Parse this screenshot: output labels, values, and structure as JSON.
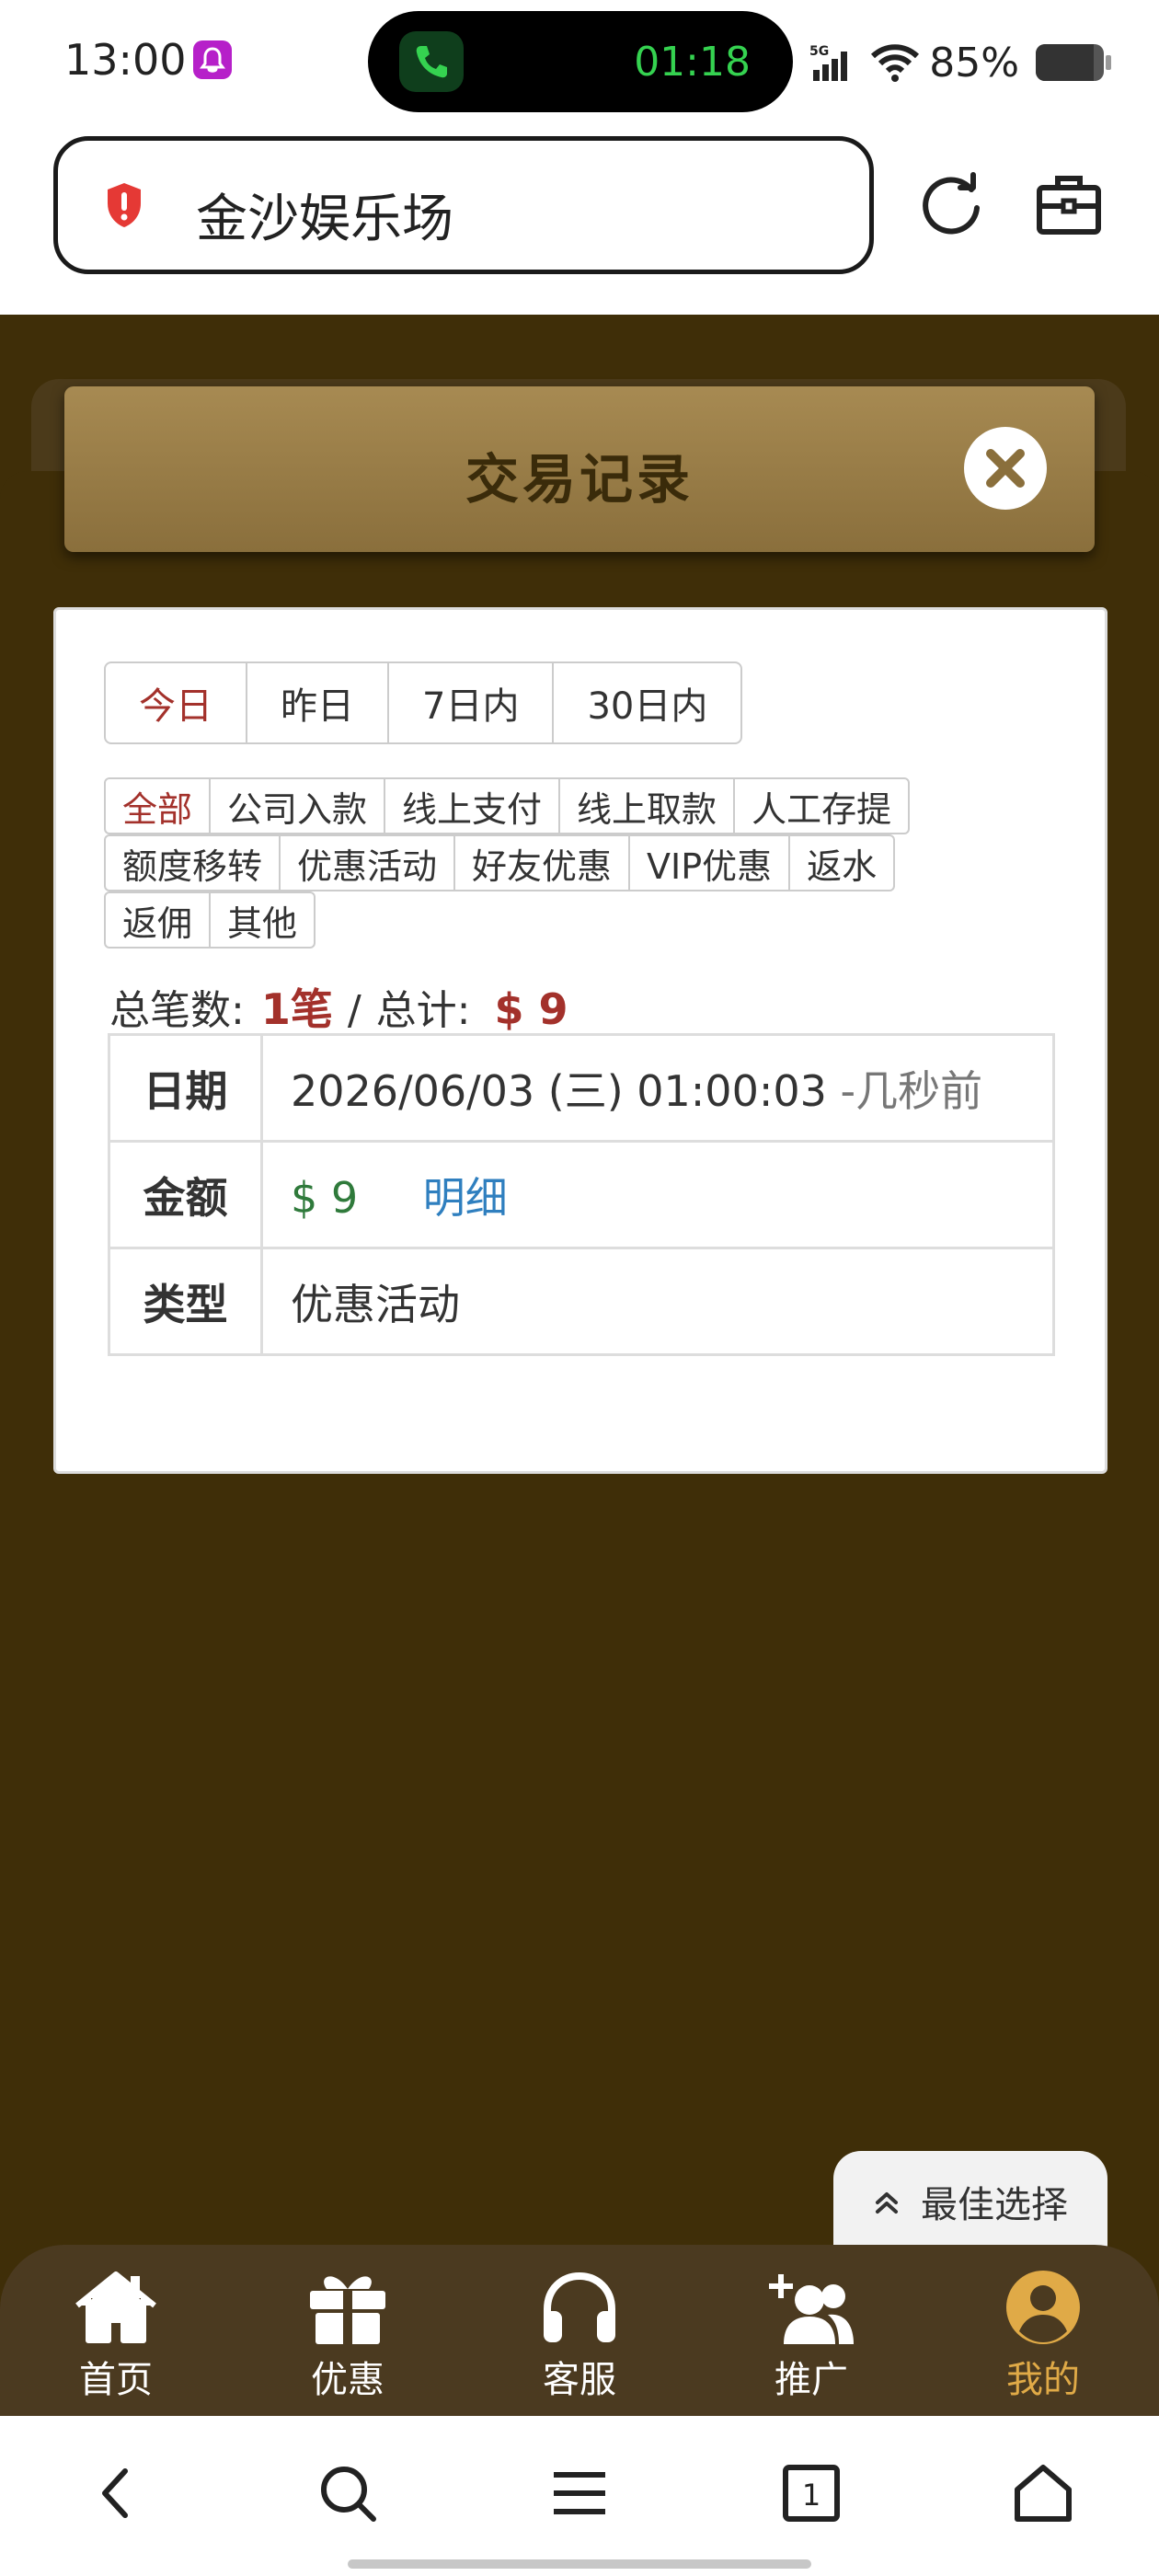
{
  "status_bar": {
    "time": "13:00",
    "call_timer": "01:18",
    "network": "5G",
    "battery_percent_label": "85%",
    "battery_level": 0.85
  },
  "address_bar": {
    "site_title": "金沙娱乐场"
  },
  "header": {
    "title": "交易记录"
  },
  "day_tabs": [
    {
      "label": "今日",
      "active": true
    },
    {
      "label": "昨日",
      "active": false
    },
    {
      "label": "7日内",
      "active": false
    },
    {
      "label": "30日内",
      "active": false
    }
  ],
  "type_filters": [
    [
      {
        "label": "全部",
        "active": true
      },
      {
        "label": "公司入款"
      },
      {
        "label": "线上支付"
      },
      {
        "label": "线上取款"
      },
      {
        "label": "人工存提"
      }
    ],
    [
      {
        "label": "额度移转"
      },
      {
        "label": "优惠活动"
      },
      {
        "label": "好友优惠"
      },
      {
        "label": "VIP优惠"
      },
      {
        "label": "返水"
      }
    ],
    [
      {
        "label": "返佣"
      },
      {
        "label": "其他"
      }
    ]
  ],
  "summary": {
    "count_label": "总笔数:",
    "count_value": "1笔",
    "separator": "/",
    "total_label": "总计:",
    "total_value": "$ 9"
  },
  "record": {
    "date_key": "日期",
    "date_value": "2026/06/03 (三) 01:00:03",
    "date_ago": "-几秒前",
    "amount_key": "金额",
    "amount_value": "$ 9",
    "detail_link": "明细",
    "type_key": "类型",
    "type_value": "优惠活动"
  },
  "best_choice": {
    "label": "最佳选择"
  },
  "app_nav": [
    {
      "label": "首页",
      "icon": "home-icon",
      "active": false
    },
    {
      "label": "优惠",
      "icon": "gift-icon",
      "active": false
    },
    {
      "label": "客服",
      "icon": "headset-icon",
      "active": false
    },
    {
      "label": "推广",
      "icon": "user-plus-icon",
      "active": false
    },
    {
      "label": "我的",
      "icon": "user-circle-icon",
      "active": true
    }
  ],
  "browser_toolbar": {
    "tab_count": "1"
  },
  "colors": {
    "app_background": "#3f2e08",
    "header_gold": "#a78a52",
    "active_red": "#a3312b",
    "amount_green": "#2f7a3b",
    "link_blue": "#2f7fbf",
    "nav_active": "#e0aa47"
  }
}
